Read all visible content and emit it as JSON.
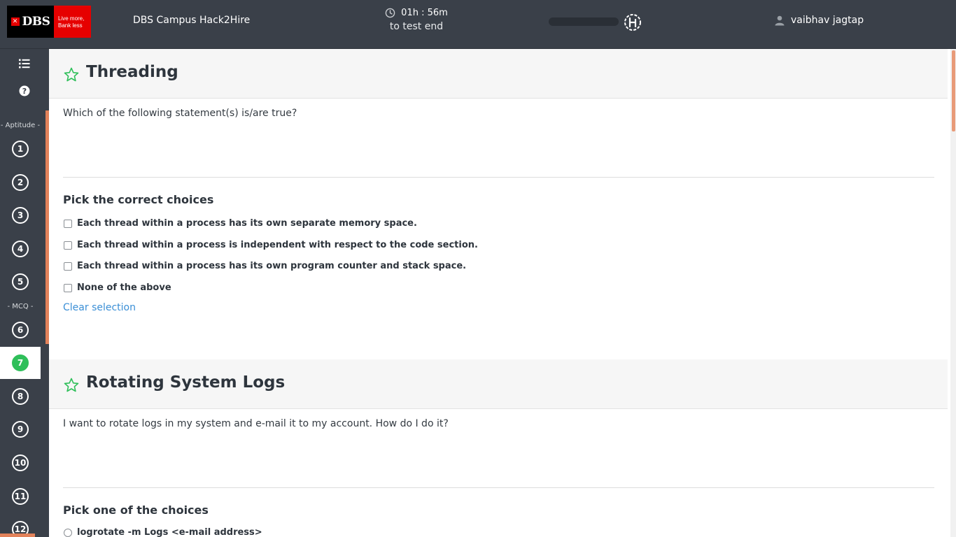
{
  "header": {
    "logo": {
      "brand": "DBS",
      "tagline_line1": "Live more,",
      "tagline_line2": "Bank less"
    },
    "app_title": "DBS Campus Hack2Hire",
    "timer": {
      "remaining": "01h : 56m",
      "caption": "to test end"
    },
    "user_name": "vaibhav jagtap"
  },
  "sidebar": {
    "sections": [
      {
        "label": "- Aptitude -"
      },
      {
        "label": "- MCQ -"
      }
    ],
    "questions": [
      "1",
      "2",
      "3",
      "4",
      "5",
      "6",
      "7",
      "8",
      "9",
      "10",
      "11",
      "12"
    ],
    "active_question": "7"
  },
  "questions": [
    {
      "title": "Threading",
      "text": "Which of the following statement(s) is/are true?",
      "pick_label": "Pick the correct choices",
      "choice_type": "checkbox",
      "choices": [
        "Each thread within a process has its own separate memory space.",
        "Each thread within a process is independent with respect to the code section.",
        "Each thread within a process has its own program counter and stack space.",
        "None of the above"
      ],
      "clear_label": "Clear selection"
    },
    {
      "title": "Rotating System Logs",
      "text": "I want to rotate logs in my system and e-mail it to my account. How do I do it?",
      "pick_label": "Pick one of the choices",
      "choice_type": "radio",
      "choices": [
        "logrotate -m Logs <e-mail address>"
      ]
    }
  ],
  "icons": {
    "menu": "list-icon",
    "help": "question-circle-icon",
    "star": "star-outline-icon",
    "clock": "clock-icon",
    "user": "user-icon",
    "hackerearth": "hackerearth-logo-icon"
  },
  "colors": {
    "header_bg": "#3a4049",
    "accent_orange": "#e2825a",
    "active_green": "#2fbf5a",
    "star_green": "#2fbf5a",
    "link_blue": "#3b8fd6"
  }
}
